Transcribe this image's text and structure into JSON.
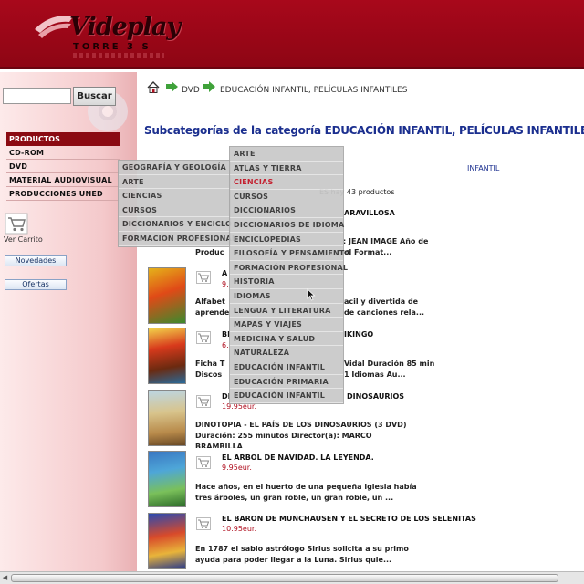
{
  "header": {
    "logo_text": "Videplay",
    "logo_sub": "TORRE 3 S"
  },
  "search": {
    "button_label": "Buscar",
    "input_value": ""
  },
  "sidebar": {
    "heading": "PRODUCTOS",
    "items": [
      "CD-ROM",
      "DVD",
      "MATERIAL AUDIOVISUAL",
      "PRODUCCIONES UNED"
    ],
    "cart_label": "Ver Carrito",
    "buttons": [
      "Novedades",
      "Ofertas"
    ]
  },
  "breadcrumb": {
    "level1": "DVD",
    "level2": "EDUCACIÓN INFANTIL, PELÍCULAS INFANTILES"
  },
  "main": {
    "title": "Subcategorías de la categoría EDUCACIÓN INFANTIL, PELÍCULAS INFANTILES",
    "subcategory_link": "INFANTIL",
    "count_text": "ES hay 43 productos"
  },
  "products": [
    {
      "title": "ARAVILLOSA",
      "price": "",
      "desc1": ": JEAN IMAGE Año de",
      "desc2": "Produc",
      "desc2b": "ol Format..."
    },
    {
      "title": "A",
      "price": "9.",
      "desc1": "Alfabet",
      "desc1b": "acil y divertida de",
      "desc2": "aprende",
      "desc2b": "de canciones rela..."
    },
    {
      "title": "BI",
      "titleb": "IKINGO",
      "price": "6.",
      "desc1": "Ficha T",
      "desc1b": "Vidal Duración 85 min",
      "desc2": "Discos",
      "desc2b": "1 Idiomas Au..."
    },
    {
      "title": "DI",
      "titleb": "DINOSAURIOS",
      "price": "19.95eur.",
      "desc1": "DINOTOPIA - EL PAÍS DE LOS DINOSAURIOS (3 DVD)",
      "desc2": "Duración: 255 minutos Director(a): MARCO",
      "desc3": "BRAMBILLA"
    },
    {
      "title": "EL ARBOL DE NAVIDAD. LA LEYENDA.",
      "price": "9.95eur.",
      "desc1": "Hace años, en el huerto de una pequeña iglesia había",
      "desc2": "tres árboles, un gran roble, un gran roble, un ..."
    },
    {
      "title": "EL BARON DE MUNCHAUSEN Y EL SECRETO DE LOS SELENITAS",
      "price": "10.95eur.",
      "desc1": "En 1787 el sabio astrólogo Sirius solicita a su primo",
      "desc2": "ayuda para poder llegar a la Luna. Sirius quie..."
    }
  ],
  "menu_dvd": [
    "GEOGRAFÍA Y GEOLOGÍA",
    "ARTE",
    "CIENCIAS",
    "CURSOS",
    "DICCIONARIOS Y ENCICLO",
    "FORMACION PROFESIONAL"
  ],
  "menu_sub": [
    "ARTE",
    "ATLAS Y TIERRA",
    "CIENCIAS",
    "CURSOS",
    "DICCIONARIOS",
    "DICCIONARIOS DE IDIOMA",
    "ENCICLOPEDIAS",
    "FILOSOFÍA Y PENSAMIENTO",
    "FORMACIÓN PROFESIONAL",
    "HISTORIA",
    "IDIOMAS",
    "LENGUA Y LITERATURA",
    "MAPAS Y VIAJES",
    "MEDICINA Y SALUD",
    "NATURALEZA",
    "EDUCACIÓN INFANTIL",
    "EDUCACIÓN PRIMARIA",
    "EDUCACIÓN INFANTIL"
  ],
  "menu_sub_active_index": 2,
  "colors": {
    "brand_red": "#a8081b",
    "link_blue": "#1b2f8f",
    "price_red": "#b01020"
  }
}
